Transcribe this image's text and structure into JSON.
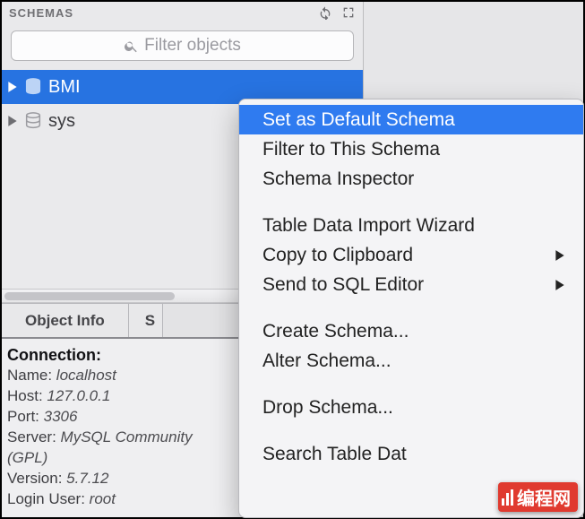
{
  "sidebar": {
    "title": "SCHEMAS",
    "search_placeholder": "Filter objects",
    "items": [
      {
        "label": "BMI",
        "selected": true
      },
      {
        "label": "sys",
        "selected": false
      }
    ]
  },
  "tabs": {
    "object_info": "Object Info",
    "second_partial": "S"
  },
  "connection": {
    "heading": "Connection:",
    "name_lbl": "Name: ",
    "name_val": "localhost",
    "host_lbl": "Host: ",
    "host_val": "127.0.0.1",
    "port_lbl": "Port: ",
    "port_val": "3306",
    "server_lbl": "Server: ",
    "server_val": "MySQL Community",
    "server_val2": "(GPL)",
    "version_lbl": "Version: ",
    "version_val": "5.7.12",
    "login_lbl": "Login User: ",
    "login_val": "root"
  },
  "menu": {
    "set_default": "Set as Default Schema",
    "filter": "Filter to This Schema",
    "inspector": "Schema Inspector",
    "import_wizard": "Table Data Import Wizard",
    "copy_clipboard": "Copy to Clipboard",
    "sql_editor": "Send to SQL Editor",
    "create_schema": "Create Schema...",
    "alter_schema": "Alter Schema...",
    "drop_schema": "Drop Schema...",
    "search_table": "Search Table Dat"
  },
  "watermark": "编程网"
}
